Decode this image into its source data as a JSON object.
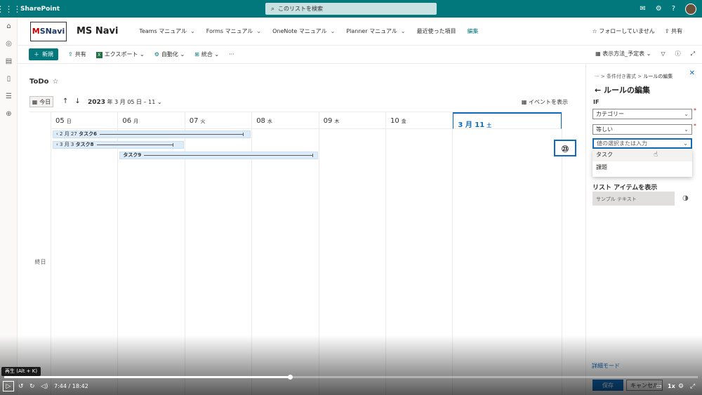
{
  "suite": {
    "brand": "SharePoint",
    "search_placeholder": "このリストを検索"
  },
  "site": {
    "logo_text_m": "M",
    "logo_text_s": "S",
    "logo_text_navi": "Navi",
    "title": "MS Navi",
    "nav": [
      {
        "label": "Teams マニュアル",
        "has_chevron": true
      },
      {
        "label": "Forms マニュアル",
        "has_chevron": true
      },
      {
        "label": "OneNote マニュアル",
        "has_chevron": true
      },
      {
        "label": "Planner マニュアル",
        "has_chevron": true
      },
      {
        "label": "最近使った項目",
        "has_chevron": false
      },
      {
        "label": "編集",
        "has_chevron": false
      }
    ],
    "follow_label": "☆ フォローしていません",
    "share_label": "共有"
  },
  "commandbar": {
    "new_label": "新規",
    "share_label": "共有",
    "export_label": "エクスポート",
    "automate_label": "自動化",
    "integrate_label": "統合",
    "more_label": "···",
    "view_label": "表示方法_予定表"
  },
  "calendar": {
    "list_title": "ToDo",
    "today_label": "今日",
    "range_prefix": "2023",
    "range_text": " 年 3 月 05 日 – 11",
    "show_events_label": "イベントを表示",
    "allday_label": "終日",
    "days": [
      {
        "num": "05",
        "dow": "日",
        "today": false
      },
      {
        "num": "06",
        "dow": "月",
        "today": false
      },
      {
        "num": "07",
        "dow": "火",
        "today": false
      },
      {
        "num": "08",
        "dow": "水",
        "today": false
      },
      {
        "num": "09",
        "dow": "木",
        "today": false
      },
      {
        "num": "10",
        "dow": "金",
        "today": false
      },
      {
        "num": "3 月 11",
        "dow": "土",
        "today": true
      }
    ],
    "events": [
      {
        "start_label": "2 月 27",
        "title": "タスク6",
        "continues_before": true,
        "day_start": 0,
        "day_end": 3
      },
      {
        "start_label": "3 月 3",
        "title": "タスク8",
        "continues_before": true,
        "day_start": 0,
        "day_end": 2
      },
      {
        "start_label": "",
        "title": "タスク9",
        "continues_before": false,
        "day_start": 1,
        "day_end": 4
      }
    ]
  },
  "panel": {
    "crumb_more": "···",
    "crumb_1": "条件付き書式",
    "crumb_2": "ルールの編集",
    "title": "ルールの編集",
    "if_label": "IF",
    "field_column": "カテゴリー",
    "field_operator": "等しい",
    "field_value_placeholder": "値の選択または入力",
    "options": [
      "タスク",
      "課題"
    ],
    "show_items_label": "リスト アイテムを表示",
    "sample_text": "サンプル テキスト",
    "advanced_label": "詳細モード",
    "save_label": "保存",
    "cancel_label": "キャンセル"
  },
  "callout": {
    "label": "㉓"
  },
  "player": {
    "tooltip": "再生 (Alt + K)",
    "time": "7:44 / 18:42",
    "progress": 0.412,
    "rate": "1x"
  },
  "colors": {
    "suite": "#03787c",
    "accent": "#0f6cbd",
    "event": "#deecf9"
  }
}
